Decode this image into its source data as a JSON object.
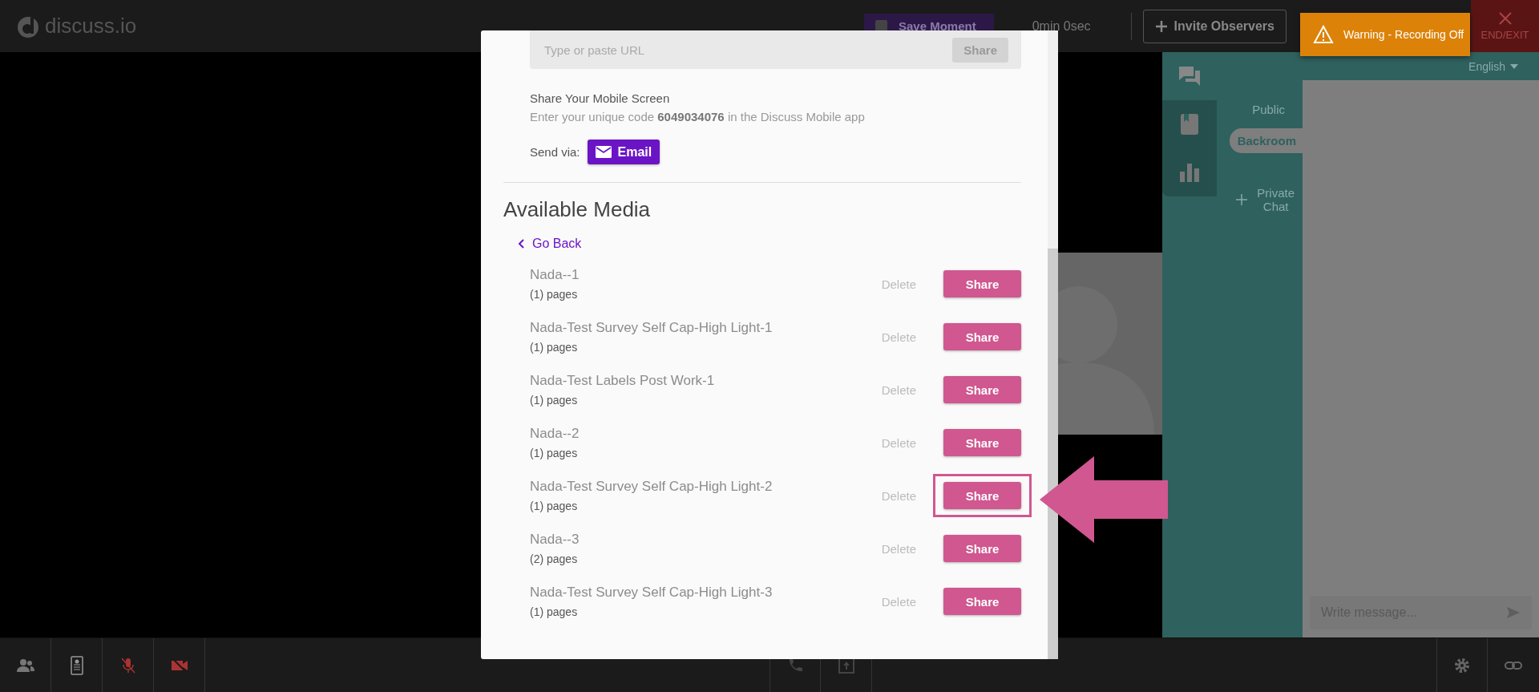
{
  "header": {
    "logo": "discuss.io",
    "save_moment": "Save Moment",
    "timer": "0min 0sec",
    "invite": "Invite Observers",
    "end_exit": "END/EXIT"
  },
  "toast": {
    "text": "Warning - Recording Off"
  },
  "side_panel": {
    "language": "English",
    "tabs": [
      {
        "kind": "chat",
        "selected": true
      },
      {
        "kind": "notes",
        "selected": false
      },
      {
        "kind": "poll",
        "selected": false
      }
    ],
    "channels": [
      {
        "label": "Public",
        "selected": false
      },
      {
        "label": "Backroom",
        "selected": true
      }
    ],
    "private_chat": "Private Chat",
    "message_placeholder": "Write message..."
  },
  "bottom_bar": {
    "mic_muted": true,
    "camera_off": true
  },
  "modal": {
    "url_placeholder": "Type or paste URL",
    "url_share": "Share",
    "mobile_title": "Share Your Mobile Screen",
    "mobile_text": "Enter your unique code **6049034076** in the Discuss Mobile app",
    "send_via": "Send via:",
    "email": "Email",
    "media_title": "Available Media",
    "go_back": "Go Back",
    "items": [
      {
        "title": "Nada--1",
        "pages": "(1) pages",
        "delete": "Delete",
        "share": "Share",
        "highlighted": false
      },
      {
        "title": "Nada-Test Survey Self Cap-High Light-1",
        "pages": "(1) pages",
        "delete": "Delete",
        "share": "Share",
        "highlighted": false
      },
      {
        "title": "Nada-Test Labels Post Work-1",
        "pages": "(1) pages",
        "delete": "Delete",
        "share": "Share",
        "highlighted": false
      },
      {
        "title": "Nada--2",
        "pages": "(1) pages",
        "delete": "Delete",
        "share": "Share",
        "highlighted": false
      },
      {
        "title": "Nada-Test Survey Self Cap-High Light-2",
        "pages": "(1) pages",
        "delete": "Delete",
        "share": "Share",
        "highlighted": true
      },
      {
        "title": "Nada--3",
        "pages": "(2) pages",
        "delete": "Delete",
        "share": "Share",
        "highlighted": false
      },
      {
        "title": "Nada-Test Survey Self Cap-High Light-3",
        "pages": "(1) pages",
        "delete": "Delete",
        "share": "Share",
        "highlighted": false
      }
    ]
  }
}
